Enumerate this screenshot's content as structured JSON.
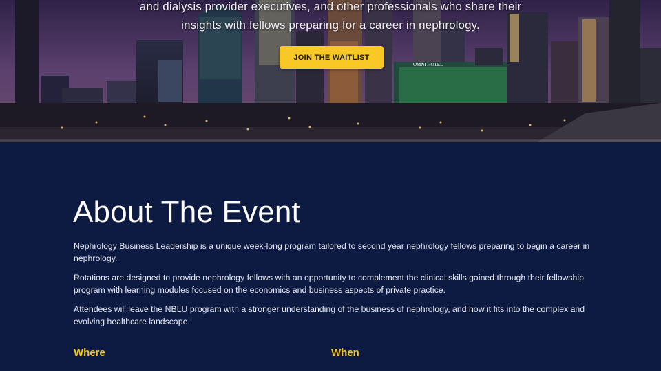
{
  "hero": {
    "text_line1": "and dialysis provider executives, and other professionals who share their",
    "text_line2": "insights with fellows preparing for a career in nephrology.",
    "cta_label": "JOIN THE WAITLIST",
    "sign_text": "OMNI HOTEL",
    "colors": {
      "cta": "#f7c826"
    }
  },
  "about": {
    "title": "About The Event",
    "paragraphs": [
      "Nephrology Business Leadership is a unique week-long program tailored to second year nephrology fellows preparing to begin a career in nephrology.",
      "Rotations are designed to provide nephrology fellows with an opportunity to complement the clinical skills gained through their fellowship program with learning modules focused on the economics and business aspects of private practice.",
      "Attendees will leave the NBLU program with a stronger understanding of the business of nephrology, and how it fits into the complex and evolving healthcare landscape."
    ],
    "where_label": "Where",
    "when_label": "When",
    "colors": {
      "background": "#0d1b43",
      "accent": "#f5c518"
    }
  }
}
